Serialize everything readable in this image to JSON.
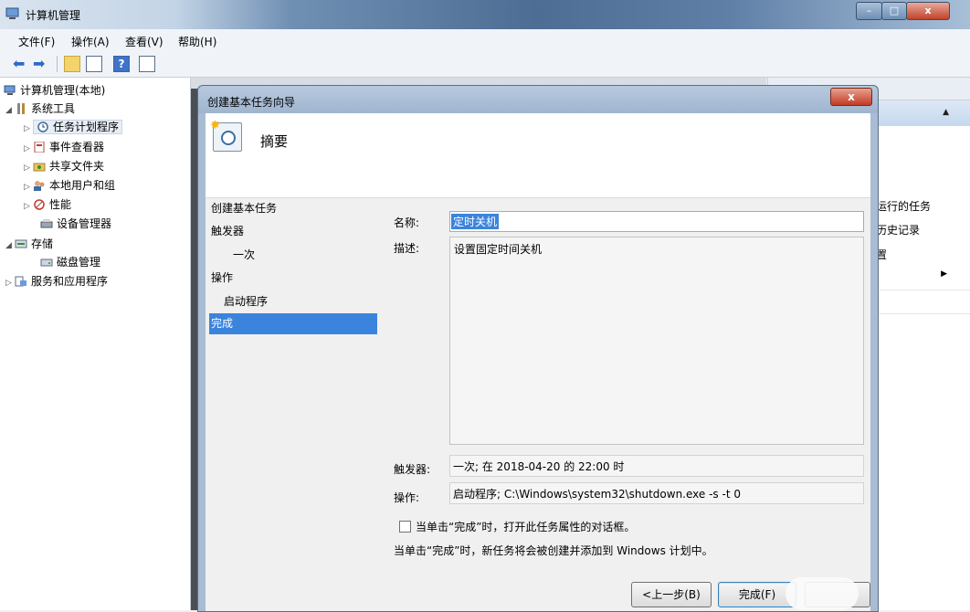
{
  "window": {
    "title": "计算机管理",
    "controls": [
      "–",
      "□",
      "x"
    ]
  },
  "menu": [
    "文件(F)",
    "操作(A)",
    "查看(V)",
    "帮助(H)"
  ],
  "toolbar": {
    "help_glyph": "?"
  },
  "tree": [
    {
      "label": "计算机管理(本地)",
      "icon": "computer-management-icon"
    },
    {
      "label": "系统工具",
      "icon": "tools-icon"
    },
    {
      "label": "任务计划程序",
      "icon": "clock-icon",
      "selected": true
    },
    {
      "label": "事件查看器",
      "icon": "event-viewer-icon"
    },
    {
      "label": "共享文件夹",
      "icon": "shared-folder-icon"
    },
    {
      "label": "本地用户和组",
      "icon": "users-icon"
    },
    {
      "label": "性能",
      "icon": "performance-icon"
    },
    {
      "label": "设备管理器",
      "icon": "device-manager-icon"
    },
    {
      "label": "存储",
      "icon": "storage-icon"
    },
    {
      "label": "磁盘管理",
      "icon": "disk-icon"
    },
    {
      "label": "服务和应用程序",
      "icon": "services-icon"
    }
  ],
  "actions": {
    "items": [
      "运行的任务",
      "历史记录",
      "置"
    ]
  },
  "dialog": {
    "title": "创建基本任务向导",
    "close": "x",
    "header_title": "摘要",
    "nav": [
      {
        "label": "创建基本任务",
        "active": false
      },
      {
        "label": "触发器",
        "active": false
      },
      {
        "label": "一次",
        "active": false
      },
      {
        "label": "操作",
        "active": false
      },
      {
        "label": "启动程序",
        "active": false
      },
      {
        "label": "完成",
        "active": true
      }
    ],
    "name_label": "名称:",
    "name_value": "定时关机",
    "desc_label": "描述:",
    "desc_value": "设置固定时间关机",
    "trigger_label": "触发器:",
    "trigger_value": "一次; 在 2018-04-20 的 22:00 时",
    "action_label": "操作:",
    "action_value": "启动程序; C:\\Windows\\system32\\shutdown.exe -s -t 0",
    "checkbox_label": "当单击“完成”时，打开此任务属性的对话框。",
    "checkbox_checked": false,
    "note": "当单击“完成”时，新任务将会被创建并添加到 Windows 计划中。",
    "back_button": "<上一步(B)",
    "finish_button": "完成(F)",
    "cancel_button": ""
  }
}
